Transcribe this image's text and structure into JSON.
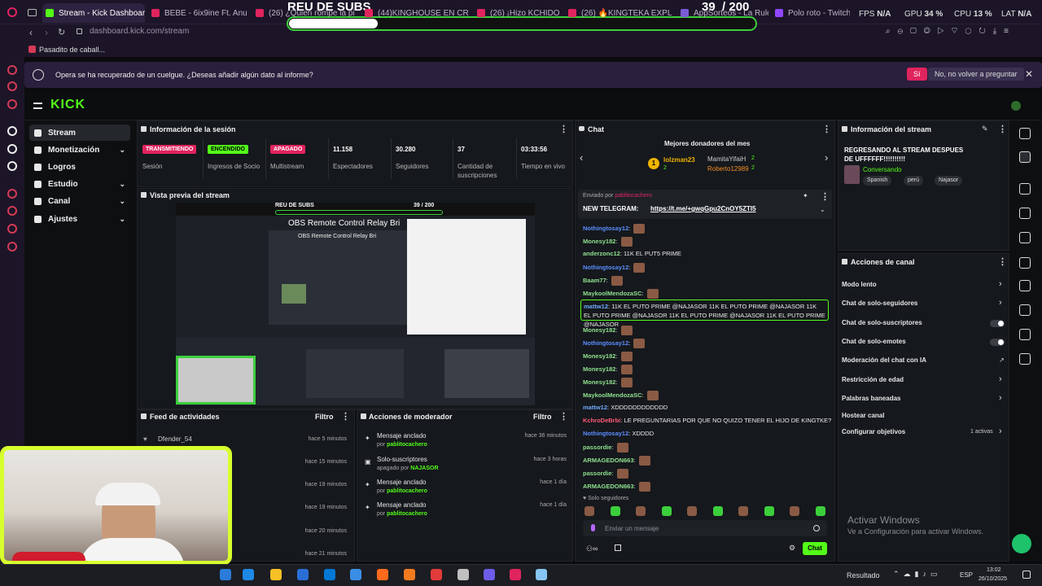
{
  "browser": {
    "tabs": [
      {
        "label": "Stream - Kick Dashboard",
        "active": true
      },
      {
        "label": "BEBE - 6ix9ine Ft. Anuel"
      },
      {
        "label": "(26) ¿Quien rompe la pi"
      },
      {
        "label": "(44)KINGHOUSE EN CR"
      },
      {
        "label": "(26) ¡Hizo KCHIDO"
      },
      {
        "label": "(26) 🔥KINGTEKA EXPL"
      },
      {
        "label": "AppSorteos - La Ruleta"
      },
      {
        "label": "Polo roto - Twitch"
      }
    ],
    "hud": {
      "fps_label": "FPS",
      "fps_value": "N/A",
      "gpu_label": "GPU",
      "gpu_value": "34 %",
      "cpu_label": "CPU",
      "cpu_value": "13 %",
      "lat_label": "LAT",
      "lat_value": "N/A"
    },
    "url": "dashboard.kick.com/stream",
    "bookmark": "Pasadito de caball...",
    "infobar": {
      "text": "Opera se ha recuperado de un cuelgue. ¿Deseas añadir algún dato al informe?",
      "yes": "Sí",
      "no": "No, no volver a preguntar"
    }
  },
  "overlay": {
    "title": "REU DE SUBS",
    "count": "39  / 200",
    "progress_fraction": 0.195
  },
  "kick": {
    "logo": "KICK",
    "sidebar": [
      {
        "label": "Stream",
        "selected": true
      },
      {
        "label": "Monetización",
        "chevron": true
      },
      {
        "label": "Logros"
      },
      {
        "label": "Estudio",
        "chevron": true
      },
      {
        "label": "Canal",
        "chevron": true
      },
      {
        "label": "Ajustes",
        "chevron": true
      }
    ],
    "session": {
      "title": "Información de la sesión",
      "stats": [
        {
          "badge": "TRANSMITIENDO",
          "label": "Sesión"
        },
        {
          "badge": "ENCENDIDO",
          "label": "Ingresos de Socio"
        },
        {
          "badge": "APAGADO",
          "label": "Multistream"
        },
        {
          "value": "11.158",
          "label": "Espectadores"
        },
        {
          "value": "30.280",
          "label": "Seguidores"
        },
        {
          "value": "37",
          "label": "Cantidad de suscripciones"
        },
        {
          "value": "03:33:56",
          "label": "Tiempo en vivo"
        }
      ]
    },
    "preview": {
      "title": "Vista previa del stream",
      "inner_title": "REU DE SUBS",
      "inner_count": "39 / 200",
      "obs_title": "OBS Remote Control Relay Bri",
      "obs_title2": "OBS Remote Control Relay Bri"
    },
    "feed": {
      "title": "Feed de actividades",
      "filter": "Filtro",
      "items": [
        {
          "user": "Dfender_54",
          "time": "hace 5 minutos"
        },
        {
          "user": "",
          "time": "hace 15 minutos"
        },
        {
          "user": "",
          "time": "hace 19 minutos"
        },
        {
          "user": "",
          "time": "hace 19 minutos"
        },
        {
          "user": "",
          "time": "hace 20 minutos"
        },
        {
          "user": "",
          "time": "hace 21 minutos"
        }
      ]
    },
    "mod": {
      "title": "Acciones de moderador",
      "filter": "Filtro",
      "items": [
        {
          "action": "Mensaje anclado",
          "by_prefix": "por",
          "by": "pablitocachero",
          "time": "hace 36 minutos"
        },
        {
          "action": "Solo-suscriptores",
          "by_prefix": "apagado por",
          "by": "NAJASOR",
          "time": "hace 3 horas"
        },
        {
          "action": "Mensaje anclado",
          "by_prefix": "por",
          "by": "pablitocachero",
          "time": "hace 1 día"
        },
        {
          "action": "Mensaje anclado",
          "by_prefix": "por",
          "by": "pablitocachero",
          "time": "hace 1 día"
        }
      ]
    },
    "chat": {
      "title": "Chat",
      "donors_title": "Mejores donadores del mes",
      "donors": [
        {
          "name": "lolzman23",
          "count": "2"
        },
        {
          "name": "MamitaYifaiH",
          "count": "2"
        },
        {
          "name": "Roberto12989",
          "count": "2"
        }
      ],
      "pinned_by": "Enviado por",
      "pinned_user": "pablitocachero",
      "pinned_label": "NEW TELEGRAM:",
      "pinned_link": "https://t.me/+gwqGpu2CnOY5ZTI5",
      "messages": [
        {
          "user": "Nothingtosay12",
          "color": "#5b8dff",
          "text": "",
          "emote": true
        },
        {
          "user": "Monesy182",
          "color": "#8fe08f",
          "text": "",
          "emote": true
        },
        {
          "user": "anderzonc12",
          "color": "#8fe08f",
          "text": "11K EL PUT5 PRIME",
          "emote": false
        },
        {
          "user": "Nothingtosay12",
          "color": "#5b8dff",
          "text": "",
          "emote": true
        },
        {
          "user": "Baam77",
          "color": "#8fe08f",
          "text": "",
          "emote": true
        },
        {
          "user": "MaykoolMendozaSC",
          "color": "#8fe08f",
          "text": "",
          "emote": true
        },
        {
          "user": "mattw12",
          "color": "#6fa8ff",
          "text": "11K EL PUTO PRIME @NAJASOR 11K EL PUTO PRIME @NAJASOR 11K EL PUTO PRIME @NAJASOR 11K EL PUTO PRIME @NAJASOR 11K EL PUTO PRIME @NAJASOR",
          "highlight": true
        },
        {
          "user": "Monesy182",
          "color": "#8fe08f",
          "text": "",
          "emote": true
        },
        {
          "user": "Nothingtosay12",
          "color": "#5b8dff",
          "text": "",
          "emote": true
        },
        {
          "user": "Monesy182",
          "color": "#8fe08f",
          "text": "",
          "emote": true
        },
        {
          "user": "Monesy182",
          "color": "#8fe08f",
          "text": "",
          "emote": true
        },
        {
          "user": "Monesy182",
          "color": "#8fe08f",
          "text": "",
          "emote": true
        },
        {
          "user": "MaykoolMendozaSC",
          "color": "#8fe08f",
          "text": "",
          "emote": true
        },
        {
          "user": "mattw12",
          "color": "#6fa8ff",
          "text": "XDDDDDDDDDDDD",
          "emote": false
        },
        {
          "user": "KchroDeBrbi",
          "color": "#ff5a7a",
          "text": "LE PREGUNTARIAS POR QUE NO QUIZO TENER EL HIJO DE KINGTKE?",
          "emote": false
        },
        {
          "user": "Nothingtosay12",
          "color": "#5b8dff",
          "text": "XDDDD",
          "emote": false
        },
        {
          "user": "passordie",
          "color": "#8fe08f",
          "text": "",
          "emote": true
        },
        {
          "user": "ARMAGEDON663",
          "color": "#8fe08f",
          "text": "",
          "emote": true
        },
        {
          "user": "passordie",
          "color": "#8fe08f",
          "text": "",
          "emote": true
        },
        {
          "user": "ARMAGEDON663",
          "color": "#8fe08f",
          "text": "",
          "emote": true
        }
      ],
      "followers_only": "Solo seguidores",
      "input_placeholder": "Enviar un mensaje",
      "send": "Chat"
    },
    "stream_info": {
      "title": "Información del stream",
      "stream_title": "REGRESANDO AL STREAM DESPUES DE UFFFFFF!!!!!!!!!!",
      "category": "Conversando",
      "tags": [
        "Spanish",
        "perú",
        "Najasor"
      ]
    },
    "channel_actions": {
      "title": "Acciones de canal",
      "items": [
        {
          "label": "Modo lento",
          "kind": "chevron"
        },
        {
          "label": "Chat de solo-seguidores",
          "kind": "chevron"
        },
        {
          "label": "Chat de solo-suscriptores",
          "kind": "toggle"
        },
        {
          "label": "Chat de solo-emotes",
          "kind": "toggle"
        },
        {
          "label": "Moderación del chat con IA",
          "kind": "external"
        },
        {
          "label": "Restricción de edad",
          "kind": "chevron"
        },
        {
          "label": "Palabras baneadas",
          "kind": "chevron"
        },
        {
          "label": "Hostear canal",
          "kind": "none"
        },
        {
          "label": "Configurar objetivos",
          "kind": "chevron",
          "extra": "1 activas"
        }
      ]
    }
  },
  "windows": {
    "activate_title": "Activar Windows",
    "activate_sub": "Ve a Configuración para activar Windows."
  },
  "taskbar": {
    "result": "Resultado",
    "lang": "ESP",
    "time": "13:02",
    "date": "26/10/2025"
  },
  "colors": {
    "kick_green": "#53fc18",
    "accent_red": "#e0245e",
    "panel": "#15181c"
  }
}
